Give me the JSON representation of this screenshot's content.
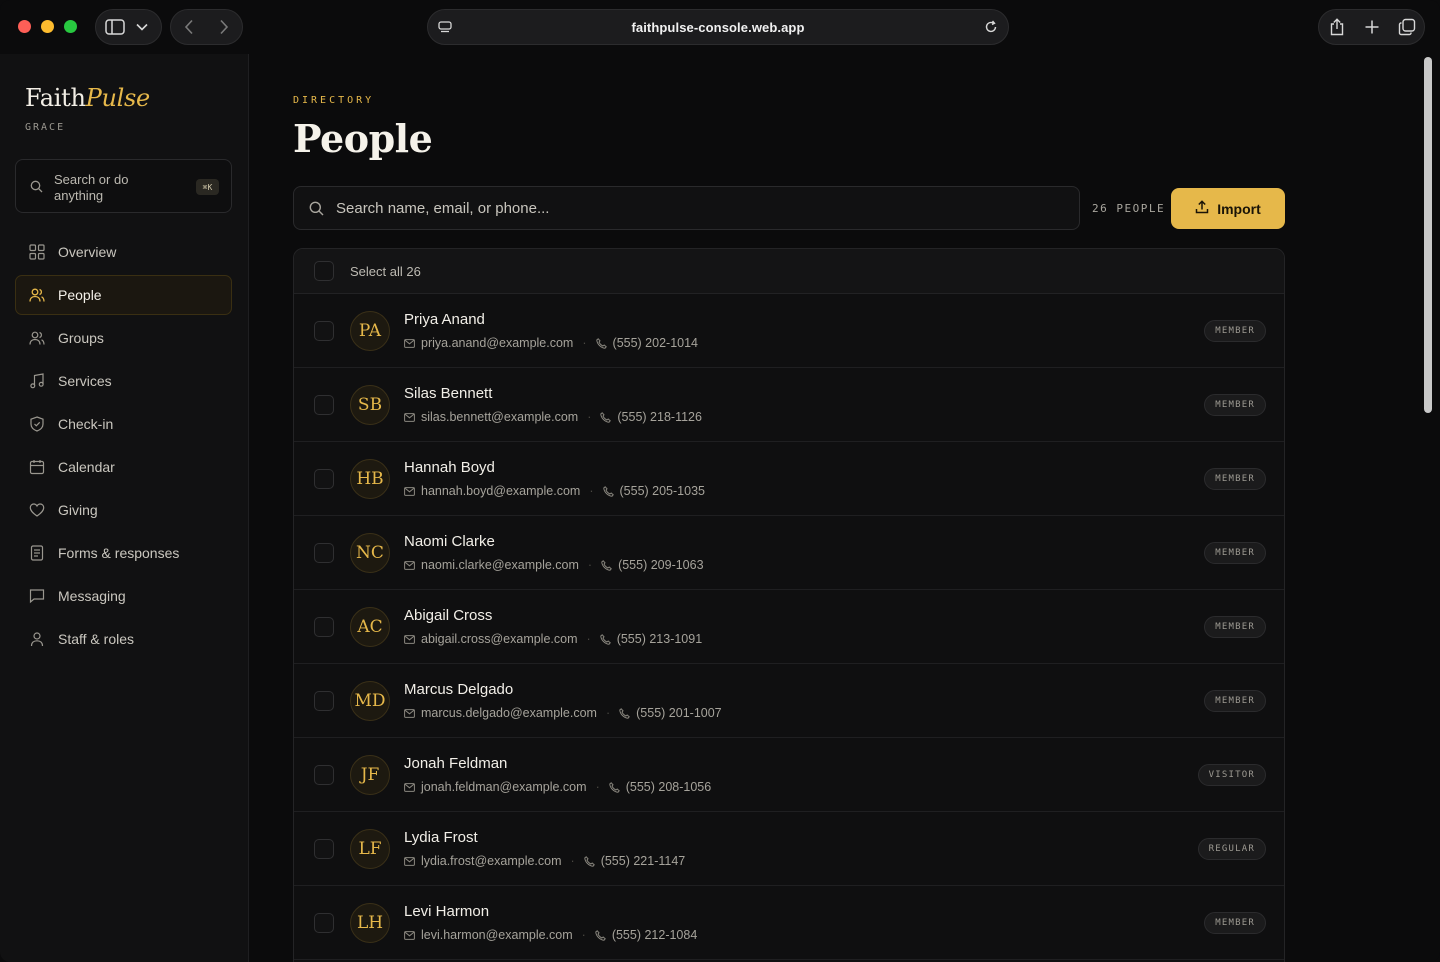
{
  "browser": {
    "url": "faithpulse-console.web.app"
  },
  "brand": {
    "name_main": "Faith",
    "name_accent": "Pulse",
    "subtitle": "GRACE"
  },
  "sidebar": {
    "search_placeholder": "Search or do anything",
    "search_shortcut": "⌘K",
    "items": [
      {
        "label": "Overview",
        "icon": "grid-icon",
        "active": false
      },
      {
        "label": "People",
        "icon": "people-icon",
        "active": true
      },
      {
        "label": "Groups",
        "icon": "groups-icon",
        "active": false
      },
      {
        "label": "Services",
        "icon": "music-note-icon",
        "active": false
      },
      {
        "label": "Check-in",
        "icon": "shield-icon",
        "active": false
      },
      {
        "label": "Calendar",
        "icon": "calendar-icon",
        "active": false
      },
      {
        "label": "Giving",
        "icon": "heart-icon",
        "active": false
      },
      {
        "label": "Forms & responses",
        "icon": "document-icon",
        "active": false
      },
      {
        "label": "Messaging",
        "icon": "message-icon",
        "active": false
      },
      {
        "label": "Staff & roles",
        "icon": "person-icon",
        "active": false
      }
    ]
  },
  "main": {
    "eyebrow": "DIRECTORY",
    "title": "People",
    "search_placeholder": "Search name, email, or phone...",
    "count_label": "26 PEOPLE",
    "import_label": "Import",
    "select_all_label": "Select all 26"
  },
  "people": [
    {
      "initials": "PA",
      "name": "Priya Anand",
      "email": "priya.anand@example.com",
      "phone": "(555) 202-1014",
      "role": "MEMBER"
    },
    {
      "initials": "SB",
      "name": "Silas Bennett",
      "email": "silas.bennett@example.com",
      "phone": "(555) 218-1126",
      "role": "MEMBER"
    },
    {
      "initials": "HB",
      "name": "Hannah Boyd",
      "email": "hannah.boyd@example.com",
      "phone": "(555) 205-1035",
      "role": "MEMBER"
    },
    {
      "initials": "NC",
      "name": "Naomi Clarke",
      "email": "naomi.clarke@example.com",
      "phone": "(555) 209-1063",
      "role": "MEMBER"
    },
    {
      "initials": "AC",
      "name": "Abigail Cross",
      "email": "abigail.cross@example.com",
      "phone": "(555) 213-1091",
      "role": "MEMBER"
    },
    {
      "initials": "MD",
      "name": "Marcus Delgado",
      "email": "marcus.delgado@example.com",
      "phone": "(555) 201-1007",
      "role": "MEMBER"
    },
    {
      "initials": "JF",
      "name": "Jonah Feldman",
      "email": "jonah.feldman@example.com",
      "phone": "(555) 208-1056",
      "role": "VISITOR"
    },
    {
      "initials": "LF",
      "name": "Lydia Frost",
      "email": "lydia.frost@example.com",
      "phone": "(555) 221-1147",
      "role": "REGULAR"
    },
    {
      "initials": "LH",
      "name": "Levi Harmon",
      "email": "levi.harmon@example.com",
      "phone": "(555) 212-1084",
      "role": "MEMBER"
    }
  ],
  "colors": {
    "accent": "#e6b84a",
    "background": "#0b0b0c",
    "sidebar": "#111112"
  }
}
